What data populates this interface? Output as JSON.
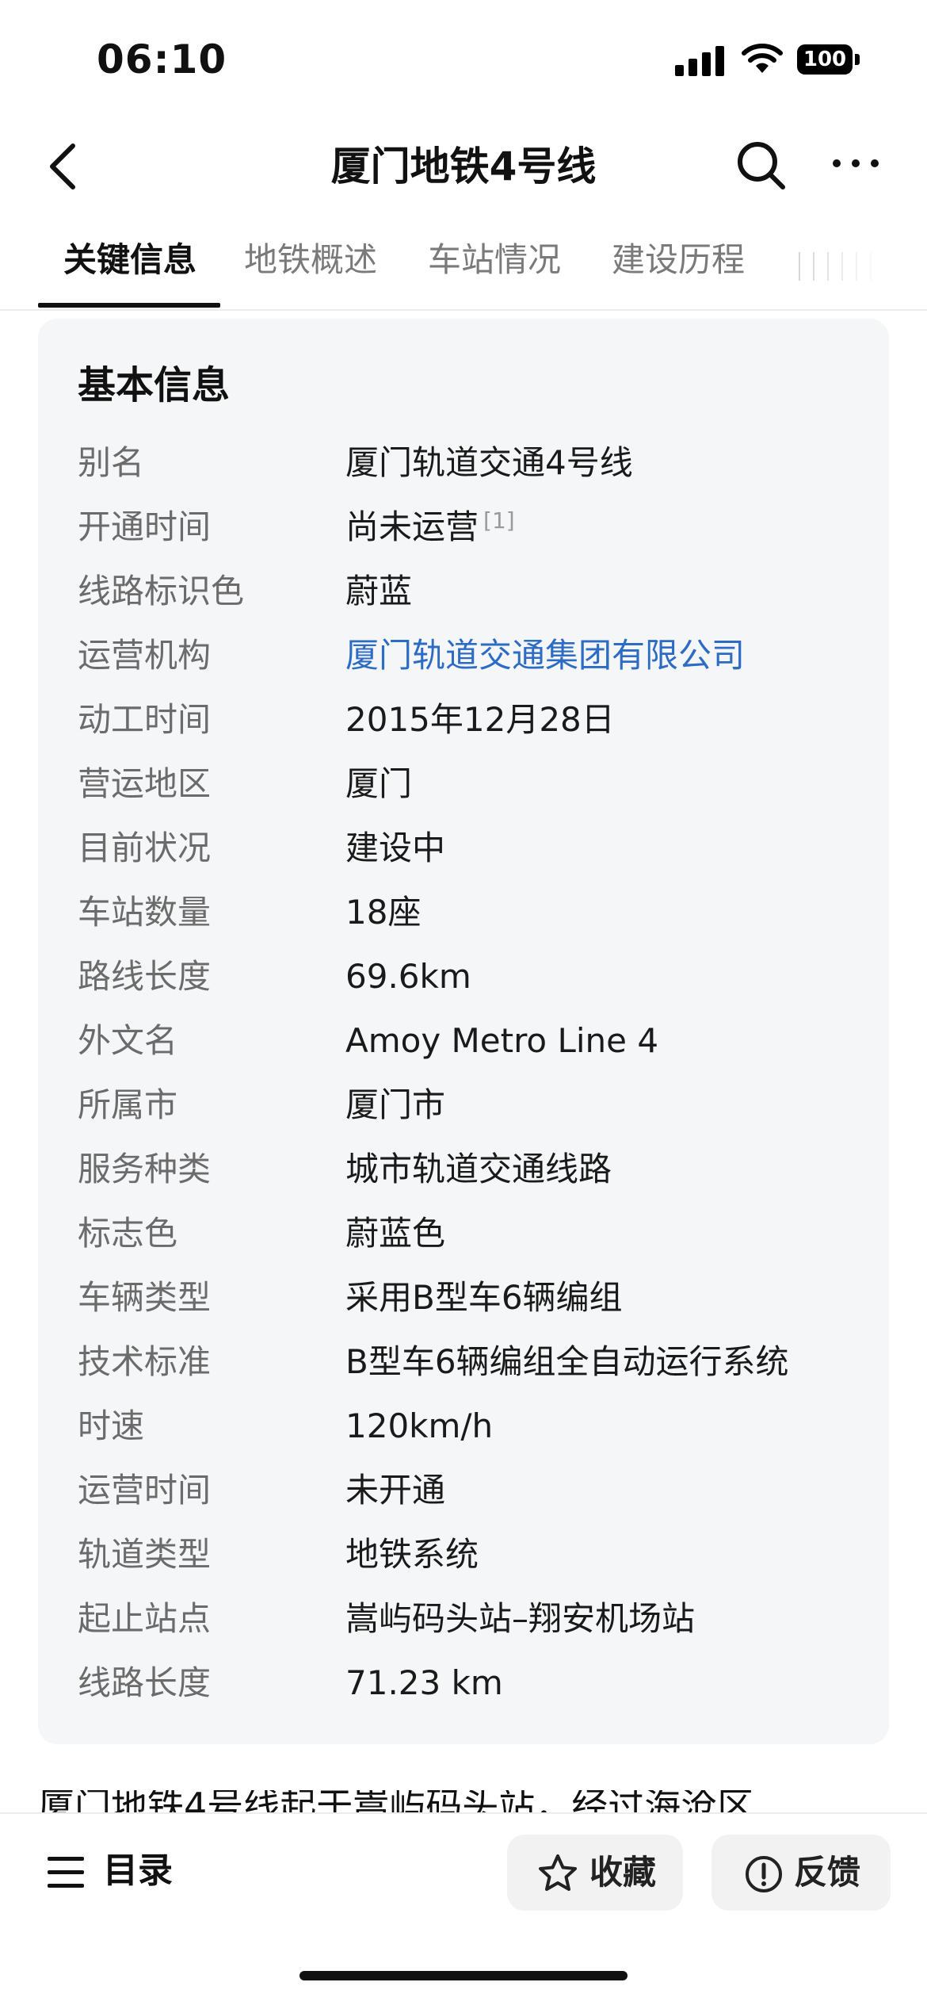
{
  "status_bar": {
    "time": "06:10",
    "battery": "100"
  },
  "nav": {
    "title": "厦门地铁4号线"
  },
  "tabs": [
    {
      "label": "关键信息"
    },
    {
      "label": "地铁概述"
    },
    {
      "label": "车站情况"
    },
    {
      "label": "建设历程"
    }
  ],
  "card": {
    "title": "基本信息",
    "rows": [
      {
        "key": "别名",
        "value": "厦门轨道交通4号线"
      },
      {
        "key": "开通时间",
        "value": "尚未运营",
        "ref": "[1]"
      },
      {
        "key": "线路标识色",
        "value": "蔚蓝"
      },
      {
        "key": "运营机构",
        "value": "厦门轨道交通集团有限公司"
      },
      {
        "key": "动工时间",
        "value": "2015年12月28日"
      },
      {
        "key": "营运地区",
        "value": "厦门"
      },
      {
        "key": "目前状况",
        "value": "建设中"
      },
      {
        "key": "车站数量",
        "value": "18座"
      },
      {
        "key": "路线长度",
        "value": "69.6km"
      },
      {
        "key": "外文名",
        "value": "Amoy Metro Line 4"
      },
      {
        "key": "所属市",
        "value": "厦门市"
      },
      {
        "key": "服务种类",
        "value": "城市轨道交通线路"
      },
      {
        "key": "标志色",
        "value": "蔚蓝色"
      },
      {
        "key": "车辆类型",
        "value": "采用B型车6辆编组"
      },
      {
        "key": "技术标准",
        "value": "B型车6辆编组全自动运行系统"
      },
      {
        "key": "时速",
        "value": "120km/h"
      },
      {
        "key": "运营时间",
        "value": "未开通"
      },
      {
        "key": "轨道类型",
        "value": "地铁系统"
      },
      {
        "key": "起止站点",
        "value": "嵩屿码头站–翔安机场站"
      },
      {
        "key": "线路长度",
        "value": "71.23 km"
      }
    ]
  },
  "paragraph_peek": "厦门地铁4号线起于嵩屿码头站，经过海沧区",
  "bottom_bar": {
    "toc_label": "目录",
    "favorite_label": "收藏",
    "feedback_label": "反馈"
  },
  "colors": {
    "link": "#2d6cc4",
    "card_bg": "#f5f6f7",
    "key_text": "#6b6b6b"
  }
}
